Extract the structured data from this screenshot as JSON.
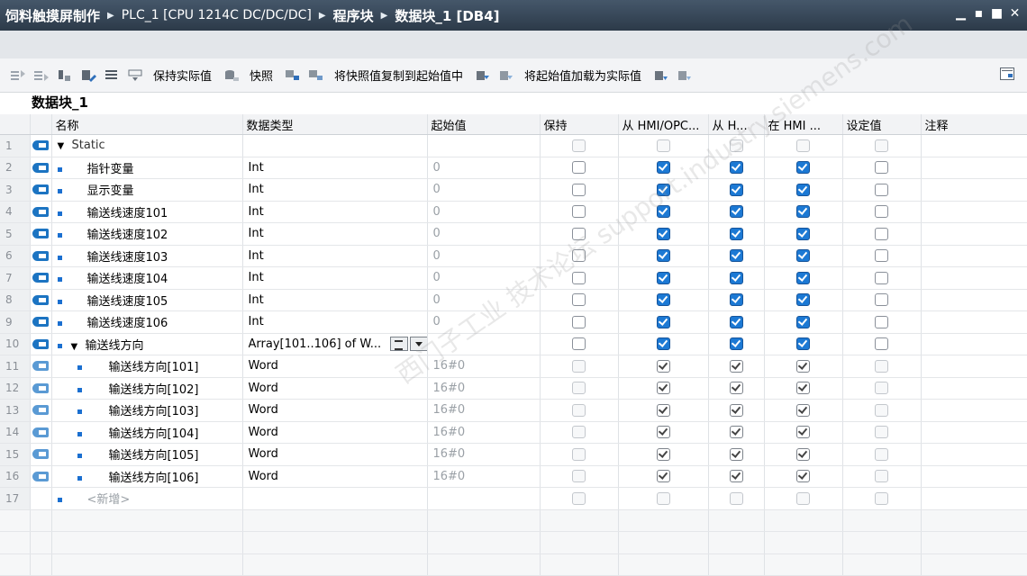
{
  "titlebar": {
    "crumbs": [
      "饲料触摸屏制作",
      "PLC_1 [CPU 1214C DC/DC/DC]",
      "程序块",
      "数据块_1 [DB4]"
    ],
    "separator": "▶",
    "controls": [
      "minimize-icon",
      "restore-icon",
      "maximize-icon",
      "close-icon"
    ]
  },
  "toolbar": {
    "keep_actual": "保持实际值",
    "snapshot": "快照",
    "copy_snapshot": "将快照值复制到起始值中",
    "load_start": "将起始值加载为实际值"
  },
  "db_title": "数据块_1",
  "columns": [
    "名称",
    "数据类型",
    "起始值",
    "保持",
    "从 HMI/OPC...",
    "从 H...",
    "在 HMI ...",
    "设定值",
    "注释"
  ],
  "rows": [
    {
      "num": "1",
      "name": "Static",
      "type": "",
      "start": ""
    },
    {
      "num": "2",
      "name": "指针变量",
      "type": "Int",
      "start": "0"
    },
    {
      "num": "3",
      "name": "显示变量",
      "type": "Int",
      "start": "0"
    },
    {
      "num": "4",
      "name": "输送线速度101",
      "type": "Int",
      "start": "0"
    },
    {
      "num": "5",
      "name": "输送线速度102",
      "type": "Int",
      "start": "0"
    },
    {
      "num": "6",
      "name": "输送线速度103",
      "type": "Int",
      "start": "0"
    },
    {
      "num": "7",
      "name": "输送线速度104",
      "type": "Int",
      "start": "0"
    },
    {
      "num": "8",
      "name": "输送线速度105",
      "type": "Int",
      "start": "0"
    },
    {
      "num": "9",
      "name": "输送线速度106",
      "type": "Int",
      "start": "0"
    },
    {
      "num": "10",
      "name": "输送线方向",
      "type": "Array[101..106] of W...",
      "start": ""
    },
    {
      "num": "11",
      "name": "输送线方向[101]",
      "type": "Word",
      "start": "16#0"
    },
    {
      "num": "12",
      "name": "输送线方向[102]",
      "type": "Word",
      "start": "16#0"
    },
    {
      "num": "13",
      "name": "输送线方向[103]",
      "type": "Word",
      "start": "16#0"
    },
    {
      "num": "14",
      "name": "输送线方向[104]",
      "type": "Word",
      "start": "16#0"
    },
    {
      "num": "15",
      "name": "输送线方向[105]",
      "type": "Word",
      "start": "16#0"
    },
    {
      "num": "16",
      "name": "输送线方向[106]",
      "type": "Word",
      "start": "16#0"
    },
    {
      "num": "17",
      "name": "<新增>",
      "type": "",
      "start": ""
    }
  ],
  "watermark": "西门子工业 技术论坛 support.industry.siemens.com"
}
